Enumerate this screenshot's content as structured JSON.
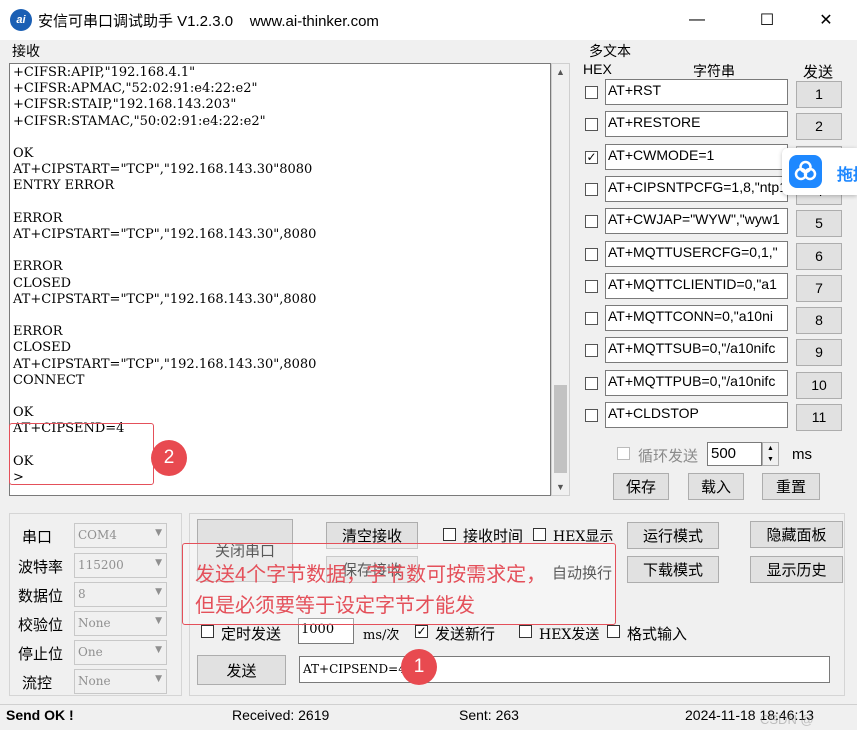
{
  "window": {
    "title": "安信可串口调试助手 V1.2.3.0    www.ai-thinker.com",
    "icon_text": "ai",
    "minimize": "—",
    "maximize": "☐",
    "close": "✕"
  },
  "receive": {
    "label": "接收",
    "content": "+CIFSR:APIP,\"192.168.4.1\"\n+CIFSR:APMAC,\"52:02:91:e4:22:e2\"\n+CIFSR:STAIP,\"192.168.143.203\"\n+CIFSR:STAMAC,\"50:02:91:e4:22:e2\"\n\nOK\nAT+CIPSTART=\"TCP\",\"192.168.143.30\"8080\nENTRY ERROR\n\nERROR\nAT+CIPSTART=\"TCP\",\"192.168.143.30\",8080\n\nERROR\nCLOSED\nAT+CIPSTART=\"TCP\",\"192.168.143.30\",8080\n\nERROR\nCLOSED\nAT+CIPSTART=\"TCP\",\"192.168.143.30\",8080\nCONNECT\n\nOK\nAT+CIPSEND=4\n\nOK\n>"
  },
  "multitext": {
    "label": "多文本",
    "col_hex": "HEX",
    "col_string": "字符串",
    "col_send": "发送",
    "rows": [
      {
        "checked": false,
        "text": "AT+RST",
        "btn": "1"
      },
      {
        "checked": false,
        "text": "AT+RESTORE",
        "btn": "2"
      },
      {
        "checked": true,
        "text": "AT+CWMODE=1",
        "btn": "3"
      },
      {
        "checked": false,
        "text": "AT+CIPSNTPCFG=1,8,\"ntp1",
        "btn": "4"
      },
      {
        "checked": false,
        "text": "AT+CWJAP=\"WYW\",\"wyw1",
        "btn": "5"
      },
      {
        "checked": false,
        "text": "AT+MQTTUSERCFG=0,1,\"",
        "btn": "6"
      },
      {
        "checked": false,
        "text": "AT+MQTTCLIENTID=0,\"a1",
        "btn": "7"
      },
      {
        "checked": false,
        "text": "AT+MQTTCONN=0,\"a10ni",
        "btn": "8"
      },
      {
        "checked": false,
        "text": "AT+MQTTSUB=0,\"/a10nifc",
        "btn": "9"
      },
      {
        "checked": false,
        "text": "AT+MQTTPUB=0,\"/a10nifc",
        "btn": "10"
      },
      {
        "checked": false,
        "text": "AT+CLDSTOP",
        "btn": "11"
      }
    ],
    "loop_send_label": "循环发送",
    "loop_interval": "500",
    "loop_unit": "ms",
    "save": "保存",
    "load": "载入",
    "reset": "重置"
  },
  "floating": {
    "text": "拖拽"
  },
  "serial": {
    "port_label": "串口",
    "port_value": "COM4",
    "baud_label": "波特率",
    "baud_value": "115200",
    "databits_label": "数据位",
    "databits_value": "8",
    "parity_label": "校验位",
    "parity_value": "None",
    "stopbits_label": "停止位",
    "stopbits_value": "One",
    "flow_label": "流控",
    "flow_value": "None"
  },
  "controls": {
    "close_port": "关闭串口",
    "clear_receive": "清空接收",
    "save_receive": "保存接收",
    "recv_time": "接收时间",
    "hex_display": "HEX显示",
    "auto_newline": "自动换行",
    "run_mode": "运行模式",
    "download_mode": "下载模式",
    "hide_panel": "隐藏面板",
    "show_history": "显示历史",
    "timed_send": "定时发送",
    "timed_interval": "1000",
    "timed_unit": "ms/次",
    "send_newline": "发送新行",
    "hex_send": "HEX发送",
    "format_input": "格式输入",
    "send": "发送",
    "send_input": "AT+CIPSEND=4"
  },
  "annotation": {
    "note_line1": "发送4个字节数据，字节数可按需求定，",
    "note_line2": "但是必须要等于设定字节才能发",
    "marker1": "1",
    "marker2": "2"
  },
  "status": {
    "state": "Send OK !",
    "received": "Received: 2619",
    "sent": "Sent: 263",
    "datetime": "2024-11-18 18:46:13",
    "watermark": "CSDN @"
  }
}
